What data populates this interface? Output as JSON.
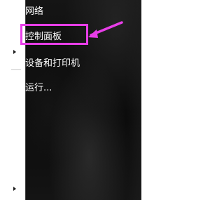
{
  "menu": {
    "items": [
      {
        "label": "网络"
      },
      {
        "label": "控制面板"
      },
      {
        "label": "设备和打印机"
      },
      {
        "label": "运行..."
      }
    ]
  },
  "annotation": {
    "highlight_color": "#e83ee8",
    "target": "控制面板"
  }
}
